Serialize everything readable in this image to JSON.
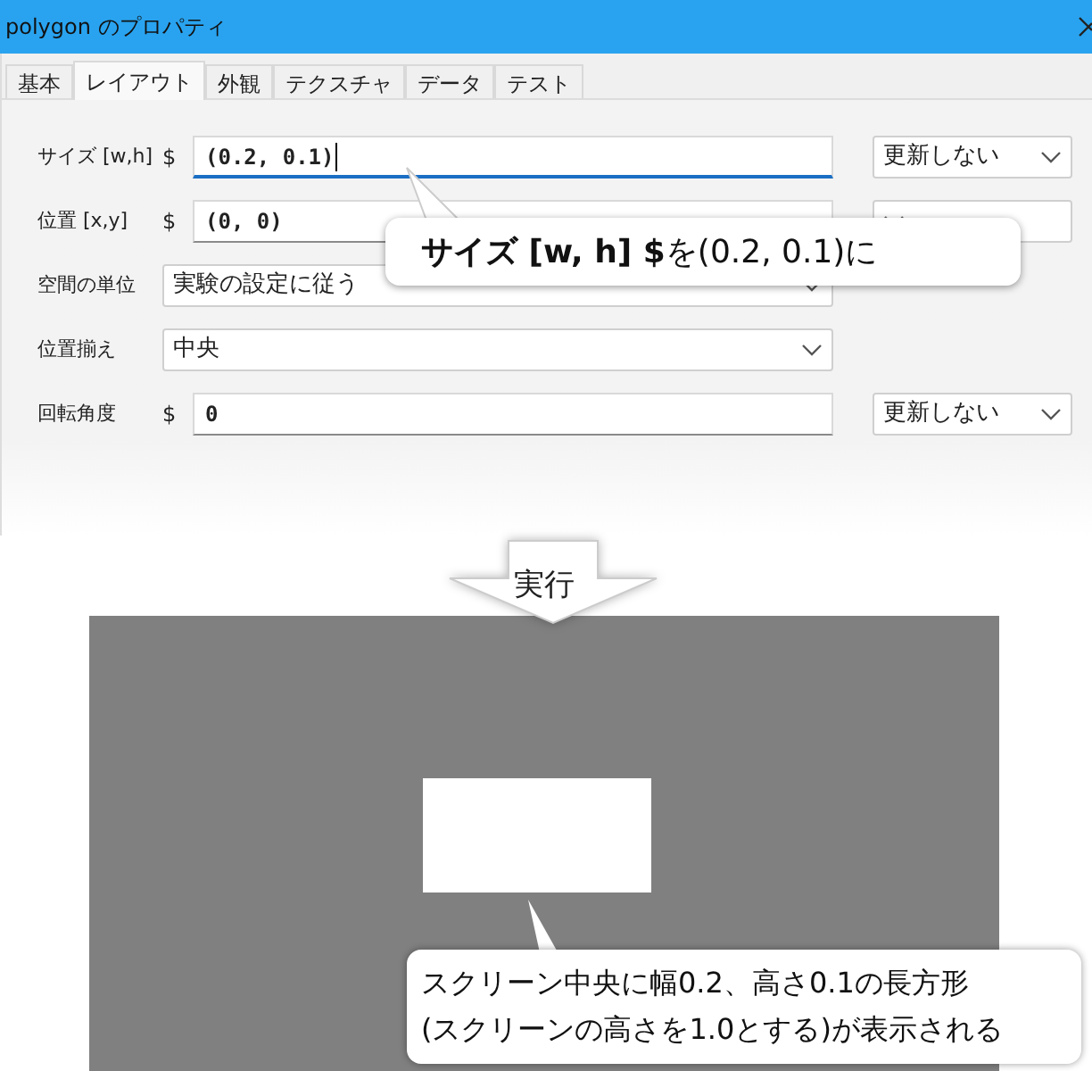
{
  "window": {
    "title": "polygon のプロパティ"
  },
  "tabs": [
    {
      "label": "基本",
      "selected": false
    },
    {
      "label": "レイアウト",
      "selected": true
    },
    {
      "label": "外観",
      "selected": false
    },
    {
      "label": "テクスチャ",
      "selected": false
    },
    {
      "label": "データ",
      "selected": false
    },
    {
      "label": "テスト",
      "selected": false
    }
  ],
  "rows": [
    {
      "kind": "expression",
      "label": "サイズ [w,h]",
      "prefix": "$",
      "value": "(0.2, 0.1)",
      "focused": true,
      "update": "更新しない"
    },
    {
      "kind": "expression",
      "label": "位置 [x,y]",
      "prefix": "$",
      "value": "(0, 0)",
      "focused": false
    },
    {
      "kind": "select",
      "label": "空間の単位",
      "value": "実験の設定に従う"
    },
    {
      "kind": "select",
      "label": "位置揃え",
      "value": "中央"
    },
    {
      "kind": "expression",
      "label": "回転角度",
      "prefix": "$",
      "value": "0",
      "focused": false,
      "update": "更新しない"
    }
  ],
  "callout": "**サイズ [w, h] $**を(0.2, 0.1)に",
  "run_arrow": "実行",
  "result_note": [
    "スクリーン中央に幅0.2、高さ0.1の長方形",
    "(スクリーンの高さを1.0とする)が表示される"
  ]
}
